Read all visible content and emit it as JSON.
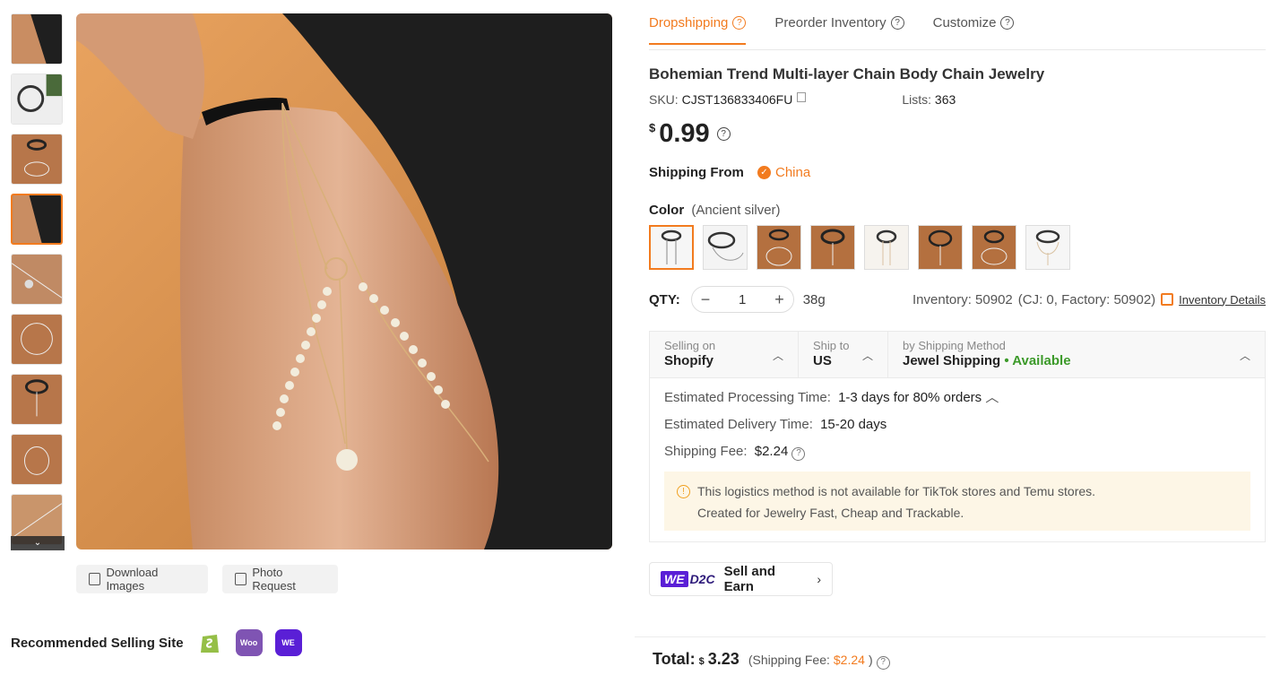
{
  "colors": {
    "accent": "#f27b1f",
    "available": "#3c9a2a",
    "warning_bg": "#fdf6e6"
  },
  "tabs": [
    {
      "label": "Dropshipping",
      "active": true
    },
    {
      "label": "Preorder Inventory",
      "active": false
    },
    {
      "label": "Customize",
      "active": false
    }
  ],
  "product": {
    "title": "Bohemian Trend Multi-layer Chain Body Chain Jewelry",
    "sku_label": "SKU:",
    "sku": "CJST136833406FU",
    "lists_label": "Lists:",
    "lists": "363",
    "price_currency": "$",
    "price": "0.99"
  },
  "shipping_from": {
    "label": "Shipping From",
    "country": "China"
  },
  "color": {
    "label": "Color",
    "selected": "(Ancient silver)",
    "swatch_icons": [
      "swatch-1",
      "swatch-2",
      "swatch-3",
      "swatch-4",
      "swatch-5",
      "swatch-6",
      "swatch-7",
      "swatch-8"
    ]
  },
  "qty": {
    "label": "QTY:",
    "value": "1",
    "minus": "−",
    "plus": "+",
    "weight": "38g",
    "inventory": "Inventory: 50902",
    "inventory_detail": "(CJ: 0, Factory: 50902)",
    "inventory_link": "Inventory Details"
  },
  "shipping": {
    "selling_on_label": "Selling on",
    "selling_on": "Shopify",
    "ship_to_label": "Ship to",
    "ship_to": "US",
    "method_label": "by Shipping Method",
    "method": "Jewel Shipping",
    "method_status": "• Available",
    "processing_label": "Estimated Processing Time:",
    "processing": "1-3 days for 80% orders",
    "delivery_label": "Estimated Delivery Time:",
    "delivery": "15-20 days",
    "fee_label": "Shipping Fee:",
    "fee": "$2.24",
    "warning_1": "This logistics method is not available for TikTok stores and Temu stores.",
    "warning_2": "Created for Jewelry Fast, Cheap and Trackable."
  },
  "d2c": {
    "we": "WE",
    "d2c": "D2C",
    "label": "Sell and Earn"
  },
  "image_actions": {
    "download": "Download Images",
    "photo_request": "Photo Request"
  },
  "recommended": {
    "title": "Recommended Selling Site",
    "sites": [
      "shopify-icon",
      "woocommerce-icon",
      "wed2c-icon"
    ],
    "woo_text": "Woo",
    "we_text": "WE"
  },
  "total": {
    "label": "Total:",
    "currency": "$",
    "amount": "3.23",
    "fee_label": "(Shipping Fee:",
    "fee": "$2.24",
    "fee_close": ")"
  }
}
